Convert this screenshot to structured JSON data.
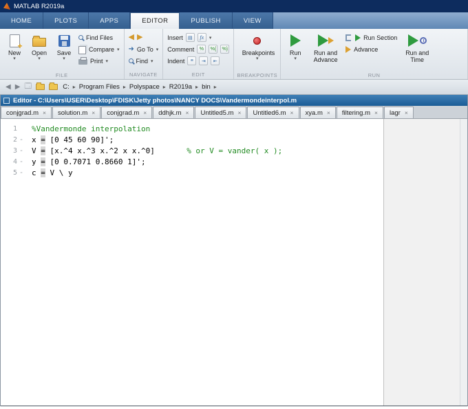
{
  "title_bar": {
    "title": "MATLAB R2019a"
  },
  "ribbon": {
    "tabs": [
      "HOME",
      "PLOTS",
      "APPS",
      "EDITOR",
      "PUBLISH",
      "VIEW"
    ],
    "active_tab": "EDITOR",
    "sections": {
      "file": {
        "label": "FILE",
        "new": "New",
        "open": "Open",
        "save": "Save",
        "find_files": "Find Files",
        "compare": "Compare",
        "print": "Print"
      },
      "navigate": {
        "label": "NAVIGATE",
        "go_to": "Go To",
        "find": "Find"
      },
      "edit": {
        "label": "EDIT",
        "insert": "Insert",
        "comment": "Comment",
        "indent": "Indent"
      },
      "breakpoints": {
        "label": "BREAKPOINTS",
        "button": "Breakpoints"
      },
      "run": {
        "label": "RUN",
        "run": "Run",
        "run_and_advance": "Run and Advance",
        "run_section": "Run Section",
        "advance": "Advance",
        "run_and_time": "Run and Time"
      }
    }
  },
  "address_bar": {
    "segments": [
      "C:",
      "Program Files",
      "Polyspace",
      "R2019a",
      "bin"
    ]
  },
  "editor": {
    "panel_title": "Editor - C:\\Users\\USER\\Desktop\\FDISK\\Jetty photos\\NANCY DOCS\\Vandermondeinterpol.m",
    "doc_tabs": [
      "conjgrad.m",
      "solution.m",
      "conjgrad.m",
      "ddhjk.m",
      "Untitled5.m",
      "Untitled6.m",
      "xya.m",
      "filtering.m",
      "lagr"
    ],
    "code_lines": [
      {
        "num": "1",
        "dash": "",
        "segments": [
          {
            "text": "%Vandermonde interpolation",
            "type": "comment"
          }
        ]
      },
      {
        "num": "2",
        "dash": "-",
        "segments": [
          {
            "text": "x ",
            "type": "plain"
          },
          {
            "text": "=",
            "type": "highlight"
          },
          {
            "text": " [0 45 60 90]';",
            "type": "plain"
          }
        ]
      },
      {
        "num": "3",
        "dash": "-",
        "segments": [
          {
            "text": "V ",
            "type": "plain"
          },
          {
            "text": "=",
            "type": "highlight"
          },
          {
            "text": " [x.^4 x.^3 x.^2 x x.^0]       ",
            "type": "plain"
          },
          {
            "text": "% or V = vander( x );",
            "type": "comment"
          }
        ]
      },
      {
        "num": "4",
        "dash": "-",
        "segments": [
          {
            "text": "y ",
            "type": "plain"
          },
          {
            "text": "=",
            "type": "highlight"
          },
          {
            "text": " [0 0.7071 0.8660 1]';",
            "type": "plain"
          }
        ]
      },
      {
        "num": "5",
        "dash": "-",
        "segments": [
          {
            "text": "c ",
            "type": "plain"
          },
          {
            "text": "=",
            "type": "highlight"
          },
          {
            "text": " V \\ y",
            "type": "plain"
          }
        ]
      }
    ]
  }
}
